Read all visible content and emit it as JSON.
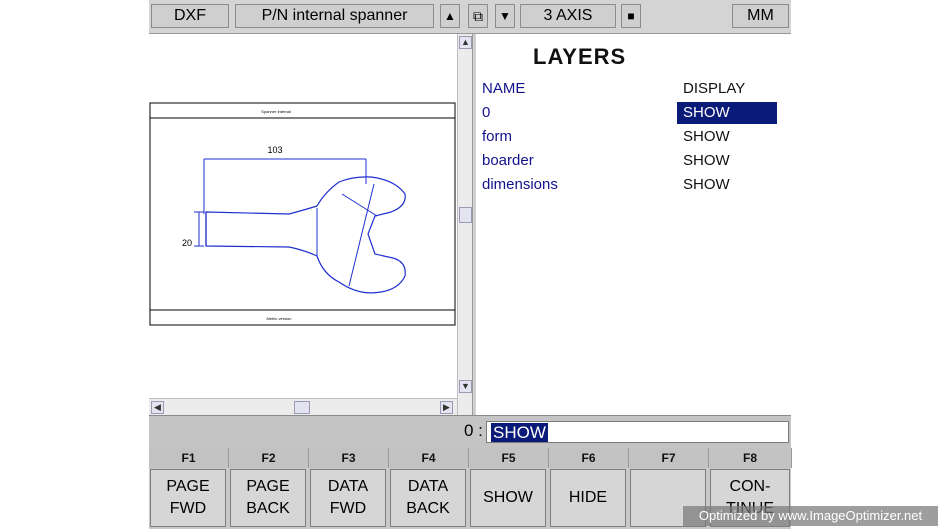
{
  "toolbar": {
    "file_type": "DXF",
    "part_name": "P/N internal spanner",
    "up_glyph": "▲",
    "view_glyph": "⧉",
    "down_glyph": "▼",
    "axis_mode": "3 AXIS",
    "stop_glyph": "■",
    "units": "MM"
  },
  "drawing": {
    "header_text": "Spanner Internal",
    "footer_text": "Metric version",
    "dim_length": "103",
    "dim_width": "20"
  },
  "layers": {
    "title": "LAYERS",
    "col_name": "NAME",
    "col_display": "DISPLAY",
    "rows": [
      {
        "name": "0",
        "display": "SHOW",
        "selected": true
      },
      {
        "name": "form",
        "display": "SHOW",
        "selected": false
      },
      {
        "name": "boarder",
        "display": "SHOW",
        "selected": false
      },
      {
        "name": "dimensions",
        "display": "SHOW",
        "selected": false
      }
    ]
  },
  "input": {
    "label": "0 :",
    "value": "SHOW"
  },
  "fkeys": [
    {
      "key": "F1",
      "line1": "PAGE",
      "line2": "FWD"
    },
    {
      "key": "F2",
      "line1": "PAGE",
      "line2": "BACK"
    },
    {
      "key": "F3",
      "line1": "DATA",
      "line2": "FWD"
    },
    {
      "key": "F4",
      "line1": "DATA",
      "line2": "BACK"
    },
    {
      "key": "F5",
      "line1": "SHOW",
      "line2": ""
    },
    {
      "key": "F6",
      "line1": "HIDE",
      "line2": ""
    },
    {
      "key": "F7",
      "line1": "",
      "line2": ""
    },
    {
      "key": "F8",
      "line1": "CON-",
      "line2": "TINUE"
    }
  ],
  "watermark": "Optimized by www.ImageOptimizer.net",
  "colors": {
    "selection": "#0a1a78",
    "layer_name": "#12128a",
    "drawing_line": "#1f2fd0"
  }
}
